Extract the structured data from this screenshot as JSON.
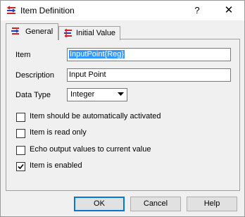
{
  "window": {
    "title": "Item Definition",
    "help_glyph": "?",
    "close_glyph": "✕"
  },
  "tabs": [
    {
      "label": "General",
      "active": true
    },
    {
      "label": "Initial Value",
      "active": false
    }
  ],
  "form": {
    "item": {
      "label": "Item",
      "value": "InputPoint{Reg}"
    },
    "description": {
      "label": "Description",
      "value": "Input Point"
    },
    "data_type": {
      "label": "Data Type",
      "value": "Integer"
    }
  },
  "checkboxes": [
    {
      "label": "Item should be automatically activated",
      "checked": false
    },
    {
      "label": "Item is read only",
      "checked": false
    },
    {
      "label": "Echo output values to current value",
      "checked": false
    },
    {
      "label": "Item is enabled",
      "checked": true
    }
  ],
  "buttons": {
    "ok": "OK",
    "cancel": "Cancel",
    "help": "Help"
  },
  "colors": {
    "accent": "#0078d7",
    "selection": "#3399ff",
    "icon_red": "#d42020",
    "icon_blue": "#2040c0"
  },
  "icons": {
    "app": "item-definition-icon",
    "tab_general": "general-tab-icon",
    "tab_initial": "initial-value-tab-icon",
    "dropdown": "chevron-down-icon",
    "check": "checkmark-icon"
  }
}
